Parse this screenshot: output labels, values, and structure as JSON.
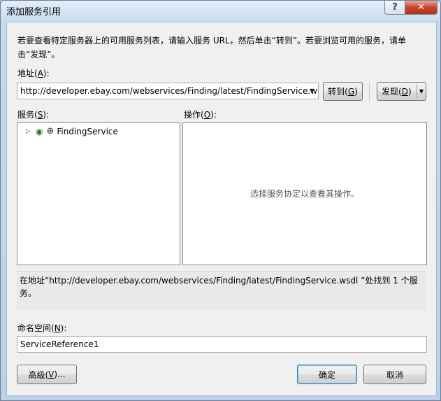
{
  "window": {
    "title": "添加服务引用",
    "help_label": "?",
    "close_label": "✕"
  },
  "description": "若要查看特定服务器上的可用服务列表，请输入服务 URL，然后单击“转到”。若要浏览可用的服务，请单击“发现”。",
  "address": {
    "label_pre": "地址(",
    "label_key": "A",
    "label_post": "):",
    "value": "http://developer.ebay.com/webservices/Finding/latest/FindingService.w"
  },
  "buttons": {
    "go_pre": "转到(",
    "go_key": "G",
    "go_post": ")",
    "discover_pre": "发现(",
    "discover_key": "D",
    "discover_post": ")",
    "advanced_pre": "高级(",
    "advanced_key": "V",
    "advanced_post": ")...",
    "ok": "确定",
    "cancel": "取消"
  },
  "services": {
    "label_pre": "服务(",
    "label_key": "S",
    "label_post": "):",
    "items": [
      {
        "name": "FindingService"
      }
    ]
  },
  "operations": {
    "label_pre": "操作(",
    "label_key": "O",
    "label_post": "):",
    "empty_message": "选择服务协定以查看其操作。"
  },
  "status_message": "在地址“http://developer.ebay.com/webservices/Finding/latest/FindingService.wsdl ”处找到 1 个服务。",
  "namespace": {
    "label_pre": "命名空间(",
    "label_key": "N",
    "label_post": "):",
    "value": "ServiceReference1"
  }
}
